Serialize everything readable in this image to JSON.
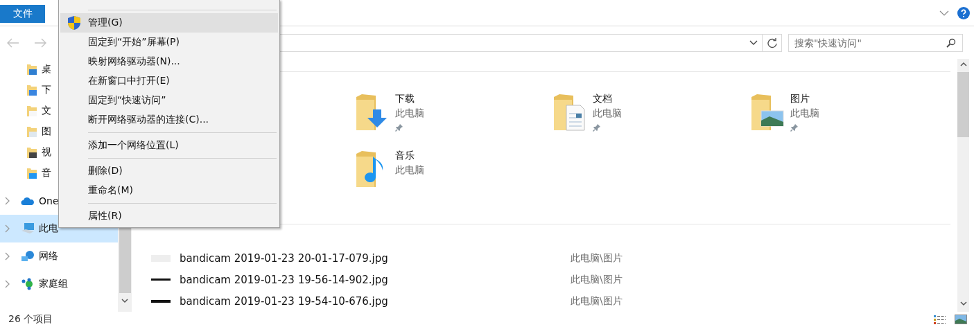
{
  "ribbon": {
    "file_tab": "文件"
  },
  "search": {
    "placeholder": "搜索\"快速访问\""
  },
  "sidebar": {
    "items": [
      {
        "label": "桌",
        "kind": "pinned",
        "selected": false
      },
      {
        "label": "下",
        "kind": "pinned",
        "selected": false
      },
      {
        "label": "文",
        "kind": "pinned",
        "selected": false
      },
      {
        "label": "图",
        "kind": "pinned",
        "selected": false
      },
      {
        "label": "视",
        "kind": "pinned",
        "selected": false
      },
      {
        "label": "音",
        "kind": "pinned",
        "selected": false
      },
      {
        "label": "One",
        "kind": "root",
        "selected": false
      },
      {
        "label": "此电",
        "kind": "root",
        "selected": true
      },
      {
        "label": "网络",
        "kind": "root",
        "selected": false
      },
      {
        "label": "家庭组",
        "kind": "root",
        "selected": false
      }
    ]
  },
  "folders": [
    {
      "name": "下载",
      "location": "此电脑",
      "pinned": true
    },
    {
      "name": "文档",
      "location": "此电脑",
      "pinned": true
    },
    {
      "name": "图片",
      "location": "此电脑",
      "pinned": true
    },
    {
      "name": "音乐",
      "location": "此电脑",
      "pinned": false
    }
  ],
  "recent_files": [
    {
      "name": "bandicam 2019-01-23 20-01-17-079.jpg",
      "location": "此电脑\\图片"
    },
    {
      "name": "bandicam 2019-01-23 19-56-14-902.jpg",
      "location": "此电脑\\图片"
    },
    {
      "name": "bandicam 2019-01-23 19-54-10-676.jpg",
      "location": "此电脑\\图片"
    }
  ],
  "status_bar": {
    "item_count": "26 个项目"
  },
  "context_menu": {
    "items": [
      {
        "kind": "separator"
      },
      {
        "kind": "item",
        "label": "管理(G)",
        "selected": true,
        "shield": true
      },
      {
        "kind": "item",
        "label": "固定到“开始”屏幕(P)",
        "selected": false
      },
      {
        "kind": "item",
        "label": "映射网络驱动器(N)...",
        "selected": false
      },
      {
        "kind": "item",
        "label": "在新窗口中打开(E)",
        "selected": false
      },
      {
        "kind": "item",
        "label": "固定到“快速访问”",
        "selected": false
      },
      {
        "kind": "item",
        "label": "断开网络驱动器的连接(C)...",
        "selected": false
      },
      {
        "kind": "separator"
      },
      {
        "kind": "item",
        "label": "添加一个网络位置(L)",
        "selected": false
      },
      {
        "kind": "separator"
      },
      {
        "kind": "item",
        "label": "删除(D)",
        "selected": false
      },
      {
        "kind": "item",
        "label": "重命名(M)",
        "selected": false
      },
      {
        "kind": "separator"
      },
      {
        "kind": "item",
        "label": "属性(R)",
        "selected": false
      }
    ]
  }
}
